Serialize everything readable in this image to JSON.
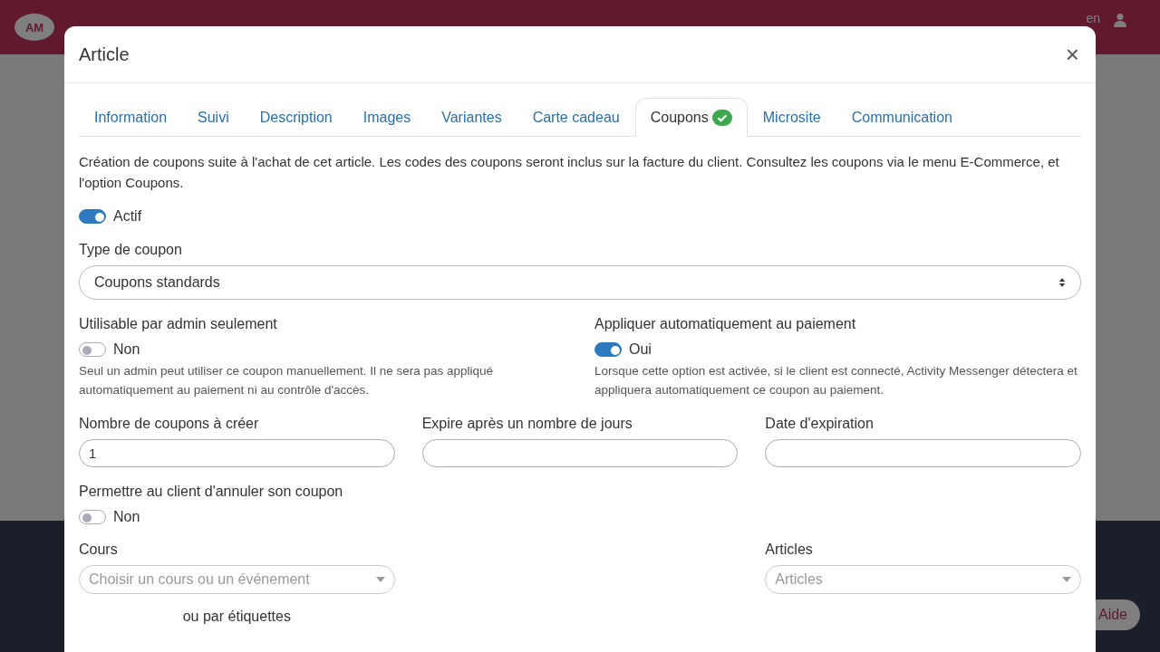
{
  "nav": {
    "logo": "AM",
    "lang": "en"
  },
  "modal": {
    "title": "Article",
    "close": "×",
    "tabs": [
      {
        "label": "Information",
        "selected": false,
        "done": false
      },
      {
        "label": "Suivi",
        "selected": false,
        "done": false
      },
      {
        "label": "Description",
        "selected": false,
        "done": false
      },
      {
        "label": "Images",
        "selected": false,
        "done": false
      },
      {
        "label": "Variantes",
        "selected": false,
        "done": false
      },
      {
        "label": "Carte cadeau",
        "selected": false,
        "done": false
      },
      {
        "label": "Coupons",
        "selected": true,
        "done": true
      },
      {
        "label": "Microsite",
        "selected": false,
        "done": false
      },
      {
        "label": "Communication",
        "selected": false,
        "done": false
      }
    ],
    "intro": "Création de coupons suite à l'achat de cet article. Les codes des coupons seront inclus sur la facture du client. Consultez les coupons via le menu E-Commerce, et l'option Coupons.",
    "active": {
      "label": "Actif",
      "on": true
    },
    "coupon_type": {
      "label": "Type de coupon",
      "value": "Coupons standards"
    },
    "options": [
      {
        "label": "Utilisable par admin seulement",
        "on": false,
        "state": "Non",
        "help": "Seul un admin peut utiliser ce coupon manuellement. Il ne sera pas appliqué automatiquement au paiement ni au contrôle d'accès."
      },
      {
        "label": "Appliquer automatiquement au paiement",
        "on": true,
        "state": "Oui",
        "help": "Lorsque cette option est activée, si le client est connecté, Activity Messenger détectera et appliquera automatiquement ce coupon au paiement."
      }
    ],
    "fields": [
      {
        "label": "Nombre de coupons à créer",
        "value": "1"
      },
      {
        "label": "Expire après un nombre de jours"
      },
      {
        "label": "Date d'expiration"
      }
    ],
    "cancel": {
      "label": "Permettre au client d'annuler son coupon",
      "on": false,
      "state": "Non"
    },
    "courses": {
      "label": "Cours",
      "placeholder": "Choisir un cours ou un événement",
      "alt": "ou par étiquettes"
    },
    "articles": {
      "label": "Articles",
      "placeholder": "Articles"
    }
  },
  "help_button": "Aide"
}
